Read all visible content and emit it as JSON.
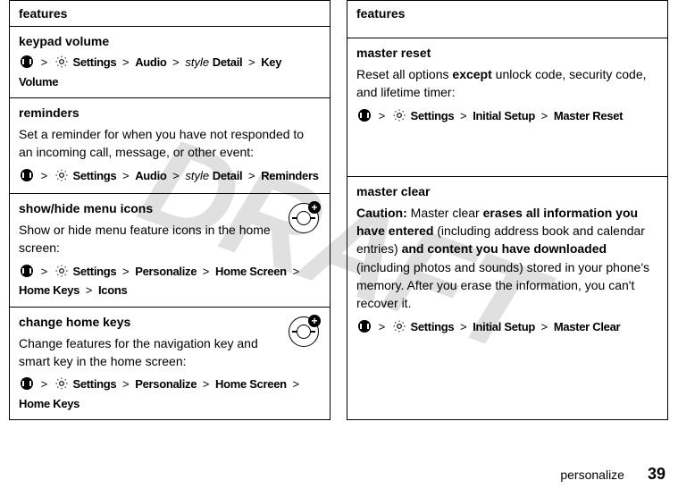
{
  "watermark": "DRAFT",
  "col1": {
    "header": "features",
    "rows": [
      {
        "title": "keypad volume",
        "nav": [
          "Settings",
          "Audio",
          "Detail",
          "Key Volume"
        ],
        "styleWord": "style"
      },
      {
        "title": "reminders",
        "body": "Set a reminder for when you have not responded to an incoming call, message, or other event:",
        "nav": [
          "Settings",
          "Audio",
          "Detail",
          "Reminders"
        ],
        "styleWord": "style"
      },
      {
        "title": "show/hide menu icons",
        "body": "Show or hide menu feature icons in the home screen:",
        "nav": [
          "Settings",
          "Personalize",
          "Home Screen",
          "Home Keys",
          "Icons"
        ],
        "badge": true
      },
      {
        "title": "change home keys",
        "body": "Change features for the navigation key and smart key in the home screen:",
        "nav": [
          "Settings",
          "Personalize",
          "Home Screen",
          "Home Keys"
        ],
        "badge": true
      }
    ]
  },
  "col2": {
    "header": "features",
    "rows": [
      {
        "title": "master reset",
        "bodyParts": [
          "Reset all options ",
          "except",
          " unlock code, security code, and lifetime timer:"
        ],
        "nav": [
          "Settings",
          "Initial Setup",
          "Master Reset"
        ]
      },
      {
        "title": "master clear",
        "caution": "Caution:",
        "bodyParts": [
          " Master clear ",
          "erases all information you have entered",
          " (including address book and calendar entries) ",
          "and content you have downloaded",
          " (including photos and sounds) stored in your phone's memory. After you erase the information, you can't recover it."
        ],
        "nav": [
          "Settings",
          "Initial Setup",
          "Master Clear"
        ]
      }
    ]
  },
  "footer": {
    "label": "personalize",
    "page": "39"
  },
  "gt": ">"
}
